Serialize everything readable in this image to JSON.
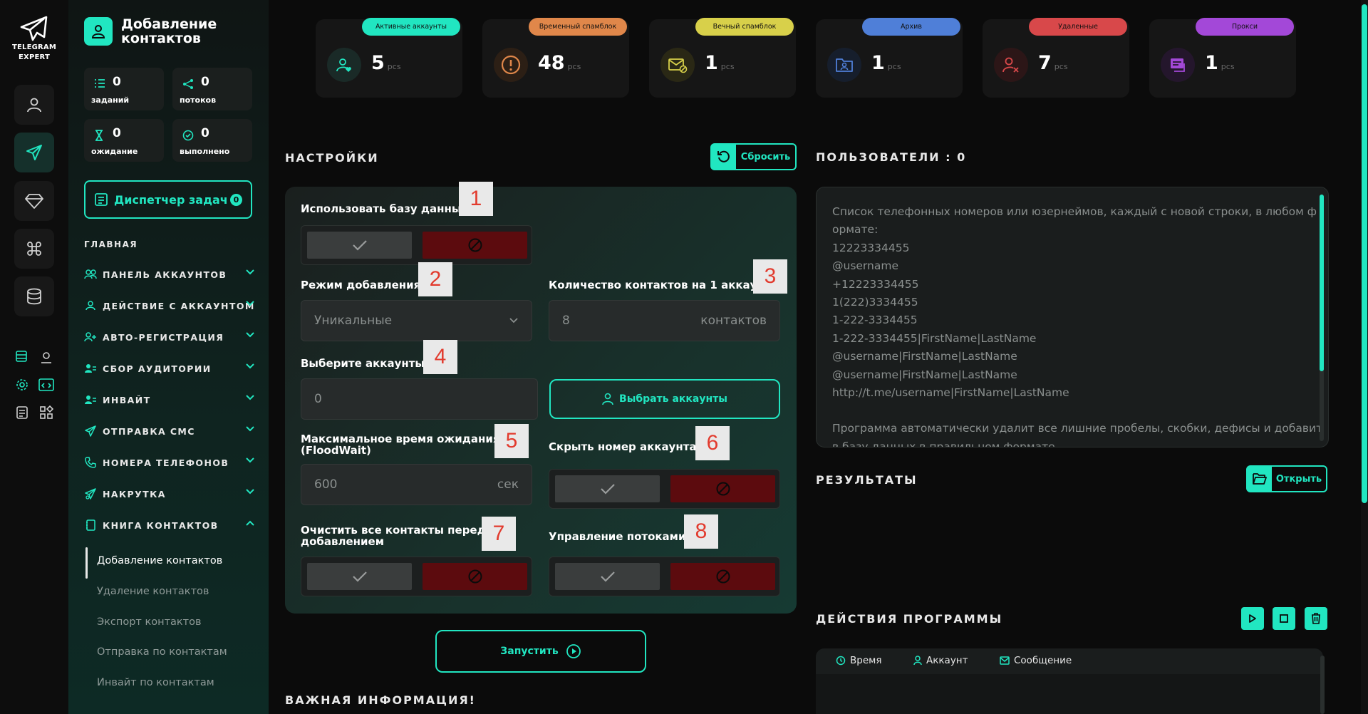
{
  "app": {
    "logo_line1": "TELEGRAM",
    "logo_line2": "EXPERT",
    "accent": "#21e6c1"
  },
  "section": {
    "title": "Добавление контактов"
  },
  "stats": {
    "tasks": {
      "value": "0",
      "label": "заданий"
    },
    "threads": {
      "value": "0",
      "label": "потоков"
    },
    "waiting": {
      "value": "0",
      "label": "ожидание"
    },
    "done": {
      "value": "0",
      "label": "выполнено"
    }
  },
  "task_manager": {
    "label": "Диспетчер задач",
    "count": "0"
  },
  "nav": {
    "heading": "ГЛАВНАЯ",
    "items": [
      {
        "label": "ПАНЕЛЬ АККАУНТОВ",
        "icon": "users-icon"
      },
      {
        "label": "ДЕЙСТВИЕ С АККАУНТОМ",
        "icon": "user-icon"
      },
      {
        "label": "АВТО-РЕГИСТРАЦИЯ",
        "icon": "user-plus-icon"
      },
      {
        "label": "СБОР АУДИТОРИИ",
        "icon": "users-list-icon"
      },
      {
        "label": "ИНВАЙТ",
        "icon": "user-invite-icon"
      },
      {
        "label": "ОТПРАВКА СМС",
        "icon": "send-icon"
      },
      {
        "label": "НОМЕРА ТЕЛЕФОНОВ",
        "icon": "phone-icon"
      },
      {
        "label": "НАКРУТКА",
        "icon": "send-boost-icon"
      },
      {
        "label": "КНИГА КОНТАКТОВ",
        "icon": "book-icon"
      }
    ],
    "sub_items": [
      "Добавление контактов",
      "Удаление контактов",
      "Экспорт контактов",
      "Отправка по контактам",
      "Инвайт по контактам"
    ]
  },
  "cards": [
    {
      "tag": "Активные аккаунты",
      "value": "5",
      "unit": "pcs",
      "color": "#21e6c1",
      "icon": "user-heart-icon"
    },
    {
      "tag": "Временный спамблок",
      "value": "48",
      "unit": "pcs",
      "color": "#e0874a",
      "icon": "warning-icon"
    },
    {
      "tag": "Вечный спамблок",
      "value": "1",
      "unit": "pcs",
      "color": "#d8d04a",
      "icon": "mail-block-icon"
    },
    {
      "tag": "Архив",
      "value": "1",
      "unit": "pcs",
      "color": "#4f7fd8",
      "icon": "folder-user-icon"
    },
    {
      "tag": "Удаленные",
      "value": "7",
      "unit": "pcs",
      "color": "#d8484a",
      "icon": "user-x-icon"
    },
    {
      "tag": "Прокси",
      "value": "1",
      "unit": "pcs",
      "color": "#a348d8",
      "icon": "proxy-icon"
    }
  ],
  "settings": {
    "heading": "НАСТРОЙКИ",
    "reset_label": "Сбросить",
    "use_db_label": "Использовать базу данных",
    "add_mode_label": "Режим добавления",
    "add_mode_value": "Уникальные",
    "contacts_per_account_label": "Количество контактов на 1 аккаунт",
    "contacts_per_account_value": "8",
    "contacts_unit": "контактов",
    "choose_accounts_label": "Выберите аккаунты",
    "choose_accounts_value": "0",
    "select_accounts_button": "Выбрать аккаунты",
    "floodwait_label_1": "Максимальное время ожидания",
    "floodwait_label_2": "(FloodWait)",
    "floodwait_value": "600",
    "floodwait_unit": "сек",
    "hide_number_label": "Скрыть номер аккаунта",
    "clear_contacts_label_1": "Очистить все контакты перед",
    "clear_contacts_label_2": "добавлением",
    "threads_label": "Управление потоками",
    "start_label": "Запустить"
  },
  "markers": [
    "1",
    "2",
    "3",
    "4",
    "5",
    "6",
    "7",
    "8"
  ],
  "important_heading": "ВАЖНАЯ ИНФОРМАЦИЯ!",
  "users": {
    "heading": "ПОЛЬЗОВАТЕЛИ : 0",
    "lines": [
      "Список телефонных номеров или юзернеймов, каждый с новой строки, в любом ф",
      "ормате:",
      "12223334455",
      "@username",
      "+12223334455",
      "1(222)3334455",
      "1-222-3334455",
      "1-222-3334455|FirstName|LastName",
      "@username|FirstName|LastName",
      "@username|FirstName|LastName",
      "http://t.me/username|FirstName|LastName",
      "",
      "Программа автоматически удалит все лишние пробелы, скобки, дефисы и добавит",
      "в базу данных в правильном формате"
    ]
  },
  "results": {
    "heading": "РЕЗУЛЬТАТЫ",
    "open_label": "Открыть"
  },
  "log": {
    "heading": "ДЕЙСТВИЯ ПРОГРАММЫ",
    "col_time": "Время",
    "col_account": "Аккаунт",
    "col_message": "Сообщение"
  }
}
